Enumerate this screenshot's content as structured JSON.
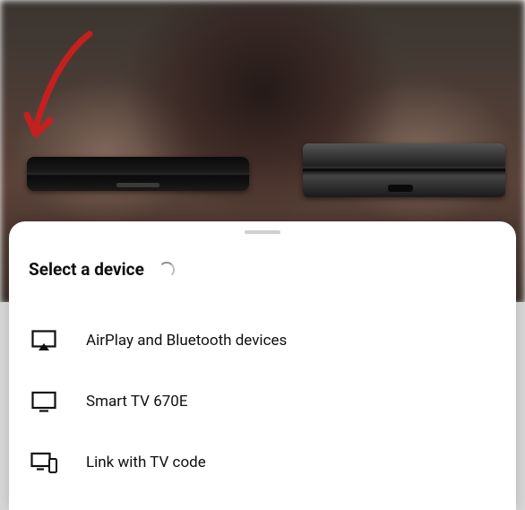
{
  "sheet": {
    "title": "Select a device",
    "devices": [
      {
        "icon": "airplay",
        "label": "AirPlay and Bluetooth devices"
      },
      {
        "icon": "tv",
        "label": "Smart TV 670E"
      },
      {
        "icon": "link-tv",
        "label": "Link with TV code"
      }
    ]
  }
}
